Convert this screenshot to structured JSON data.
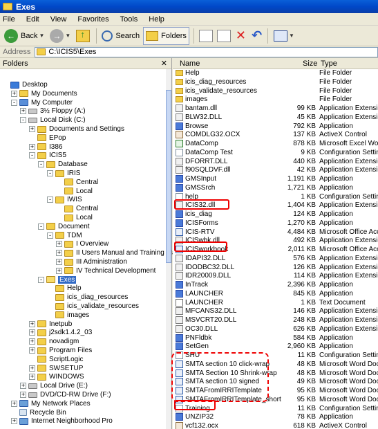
{
  "window": {
    "title": "Exes"
  },
  "menu": [
    "File",
    "Edit",
    "View",
    "Favorites",
    "Tools",
    "Help"
  ],
  "toolbar": {
    "back": "Back",
    "search": "Search",
    "folders": "Folders"
  },
  "address": {
    "label": "Address",
    "path": "C:\\ICIS5\\Exes"
  },
  "folder_pane": {
    "title": "Folders",
    "tree": [
      {
        "label": "Desktop",
        "level": 0,
        "exp": "",
        "icon": "desk"
      },
      {
        "label": "My Documents",
        "level": 1,
        "exp": "+",
        "icon": "folder"
      },
      {
        "label": "My Computer",
        "level": 1,
        "exp": "-",
        "icon": "pc"
      },
      {
        "label": "3½ Floppy (A:)",
        "level": 2,
        "exp": "+",
        "icon": "drive"
      },
      {
        "label": "Local Disk (C:)",
        "level": 2,
        "exp": "-",
        "icon": "drive"
      },
      {
        "label": "Documents and Settings",
        "level": 3,
        "exp": "+",
        "icon": "folder"
      },
      {
        "label": "EPop",
        "level": 3,
        "exp": "",
        "icon": "folder"
      },
      {
        "label": "I386",
        "level": 3,
        "exp": "+",
        "icon": "folder"
      },
      {
        "label": "ICIS5",
        "level": 3,
        "exp": "-",
        "icon": "folder"
      },
      {
        "label": "Database",
        "level": 4,
        "exp": "-",
        "icon": "folder"
      },
      {
        "label": "IRIS",
        "level": 5,
        "exp": "-",
        "icon": "folder"
      },
      {
        "label": "Central",
        "level": 6,
        "exp": "",
        "icon": "folder"
      },
      {
        "label": "Local",
        "level": 6,
        "exp": "",
        "icon": "folder"
      },
      {
        "label": "IWIS",
        "level": 5,
        "exp": "-",
        "icon": "folder"
      },
      {
        "label": "Central",
        "level": 6,
        "exp": "",
        "icon": "folder"
      },
      {
        "label": "Local",
        "level": 6,
        "exp": "",
        "icon": "folder"
      },
      {
        "label": "Document",
        "level": 4,
        "exp": "-",
        "icon": "folder"
      },
      {
        "label": "TDM",
        "level": 5,
        "exp": "-",
        "icon": "folder"
      },
      {
        "label": "I Overview",
        "level": 6,
        "exp": "+",
        "icon": "folder"
      },
      {
        "label": "II Users Manual and Training Material",
        "level": 6,
        "exp": "+",
        "icon": "folder"
      },
      {
        "label": "III Administration",
        "level": 6,
        "exp": "+",
        "icon": "folder"
      },
      {
        "label": "IV Technical Development",
        "level": 6,
        "exp": "+",
        "icon": "folder"
      },
      {
        "label": "Exes",
        "level": 4,
        "exp": "-",
        "icon": "open",
        "selected": true
      },
      {
        "label": "Help",
        "level": 5,
        "exp": "",
        "icon": "folder"
      },
      {
        "label": "icis_diag_resources",
        "level": 5,
        "exp": "",
        "icon": "folder"
      },
      {
        "label": "icis_validate_resources",
        "level": 5,
        "exp": "",
        "icon": "folder"
      },
      {
        "label": "images",
        "level": 5,
        "exp": "",
        "icon": "folder"
      },
      {
        "label": "Inetpub",
        "level": 3,
        "exp": "+",
        "icon": "folder"
      },
      {
        "label": "j2sdk1.4.2_03",
        "level": 3,
        "exp": "+",
        "icon": "folder"
      },
      {
        "label": "novadigm",
        "level": 3,
        "exp": "+",
        "icon": "folder"
      },
      {
        "label": "Program Files",
        "level": 3,
        "exp": "+",
        "icon": "folder"
      },
      {
        "label": "ScriptLogic",
        "level": 3,
        "exp": "",
        "icon": "folder"
      },
      {
        "label": "SWSETUP",
        "level": 3,
        "exp": "+",
        "icon": "folder"
      },
      {
        "label": "WINDOWS",
        "level": 3,
        "exp": "+",
        "icon": "folder"
      },
      {
        "label": "Local Drive (E:)",
        "level": 2,
        "exp": "+",
        "icon": "drive"
      },
      {
        "label": "DVD/CD-RW Drive (F:)",
        "level": 2,
        "exp": "+",
        "icon": "drive"
      },
      {
        "label": "My Network Places",
        "level": 1,
        "exp": "+",
        "icon": "net"
      },
      {
        "label": "Recycle Bin",
        "level": 1,
        "exp": "",
        "icon": "bin"
      },
      {
        "label": "Internet Neighborhood Pro",
        "level": 1,
        "exp": "+",
        "icon": "net"
      }
    ]
  },
  "file_list": {
    "columns": {
      "name": "Name",
      "size": "Size",
      "type": "Type"
    },
    "rows": [
      {
        "name": "Help",
        "size": "",
        "type": "File Folder",
        "icon": "folder"
      },
      {
        "name": "icis_diag_resources",
        "size": "",
        "type": "File Folder",
        "icon": "folder"
      },
      {
        "name": "icis_validate_resources",
        "size": "",
        "type": "File Folder",
        "icon": "folder"
      },
      {
        "name": "images",
        "size": "",
        "type": "File Folder",
        "icon": "folder"
      },
      {
        "name": "bantam.dll",
        "size": "99 KB",
        "type": "Application Extension",
        "icon": "dll"
      },
      {
        "name": "BLW32.DLL",
        "size": "45 KB",
        "type": "Application Extension",
        "icon": "dll"
      },
      {
        "name": "Browse",
        "size": "792 KB",
        "type": "Application",
        "icon": "exe"
      },
      {
        "name": "COMDLG32.OCX",
        "size": "137 KB",
        "type": "ActiveX Control",
        "icon": "ocx"
      },
      {
        "name": "DataComp",
        "size": "878 KB",
        "type": "Microsoft Excel Wor...",
        "icon": "xls"
      },
      {
        "name": "DataComp Test",
        "size": "9 KB",
        "type": "Configuration Settings",
        "icon": "cfg"
      },
      {
        "name": "DFORRT.DLL",
        "size": "440 KB",
        "type": "Application Extension",
        "icon": "dll"
      },
      {
        "name": "f90SQLDVF.dll",
        "size": "42 KB",
        "type": "Application Extension",
        "icon": "dll"
      },
      {
        "name": "GMSInput",
        "size": "1,191 KB",
        "type": "Application",
        "icon": "exe"
      },
      {
        "name": "GMSSrch",
        "size": "1,721 KB",
        "type": "Application",
        "icon": "exe"
      },
      {
        "name": "help",
        "size": "1 KB",
        "type": "Configuration Settings",
        "icon": "cfg"
      },
      {
        "name": "ICIS32.dll",
        "size": "1,404 KB",
        "type": "Application Extension",
        "icon": "dll"
      },
      {
        "name": "icis_diag",
        "size": "124 KB",
        "type": "Application",
        "icon": "exe"
      },
      {
        "name": "ICISForms",
        "size": "1,270 KB",
        "type": "Application",
        "icon": "exe"
      },
      {
        "name": "ICIS-RTV",
        "size": "4,484 KB",
        "type": "Microsoft Office Acc...",
        "icon": "doc"
      },
      {
        "name": "ICISwbk.dll",
        "size": "492 KB",
        "type": "Application Extension",
        "icon": "dll"
      },
      {
        "name": "ICISworkbook",
        "size": "2,011 KB",
        "type": "Microsoft Office Acc...",
        "icon": "doc"
      },
      {
        "name": "IDAPI32.DLL",
        "size": "576 KB",
        "type": "Application Extension",
        "icon": "dll"
      },
      {
        "name": "IDODBC32.DLL",
        "size": "126 KB",
        "type": "Application Extension",
        "icon": "dll"
      },
      {
        "name": "IDR20009.DLL",
        "size": "114 KB",
        "type": "Application Extension",
        "icon": "dll"
      },
      {
        "name": "InTrack",
        "size": "2,396 KB",
        "type": "Application",
        "icon": "exe"
      },
      {
        "name": "LAUNCHER",
        "size": "845 KB",
        "type": "Application",
        "icon": "exe"
      },
      {
        "name": "LAUNCHER",
        "size": "1 KB",
        "type": "Text Document",
        "icon": "txt"
      },
      {
        "name": "MFCANS32.DLL",
        "size": "146 KB",
        "type": "Application Extension",
        "icon": "dll"
      },
      {
        "name": "MSVCRT20.DLL",
        "size": "248 KB",
        "type": "Application Extension",
        "icon": "dll"
      },
      {
        "name": "OC30.DLL",
        "size": "626 KB",
        "type": "Application Extension",
        "icon": "dll"
      },
      {
        "name": "PNFldbk",
        "size": "584 KB",
        "type": "Application",
        "icon": "exe"
      },
      {
        "name": "SetGen",
        "size": "2,960 KB",
        "type": "Application",
        "icon": "exe"
      },
      {
        "name": "SHU",
        "size": "11 KB",
        "type": "Configuration Settings",
        "icon": "cfg"
      },
      {
        "name": "SMTA section 10 click-wrap",
        "size": "48 KB",
        "type": "Microsoft Word Doc...",
        "icon": "doc"
      },
      {
        "name": "SMTA Section 10 Shrink-wrap",
        "size": "48 KB",
        "type": "Microsoft Word Doc...",
        "icon": "doc"
      },
      {
        "name": "SMTA section 10 signed",
        "size": "49 KB",
        "type": "Microsoft Word Doc...",
        "icon": "doc"
      },
      {
        "name": "SMTAFromIRRITemplate",
        "size": "95 KB",
        "type": "Microsoft Word Doc...",
        "icon": "doc"
      },
      {
        "name": "SMTAFromIRRITemplate_short",
        "size": "95 KB",
        "type": "Microsoft Word Doc...",
        "icon": "doc"
      },
      {
        "name": "Training",
        "size": "11 KB",
        "type": "Configuration Settings",
        "icon": "cfg"
      },
      {
        "name": "UNZIP32",
        "size": "78 KB",
        "type": "Application",
        "icon": "exe"
      },
      {
        "name": "vcf132.ocx",
        "size": "618 KB",
        "type": "ActiveX Control",
        "icon": "ocx"
      }
    ]
  },
  "annotations": {
    "color": "#e00000"
  }
}
